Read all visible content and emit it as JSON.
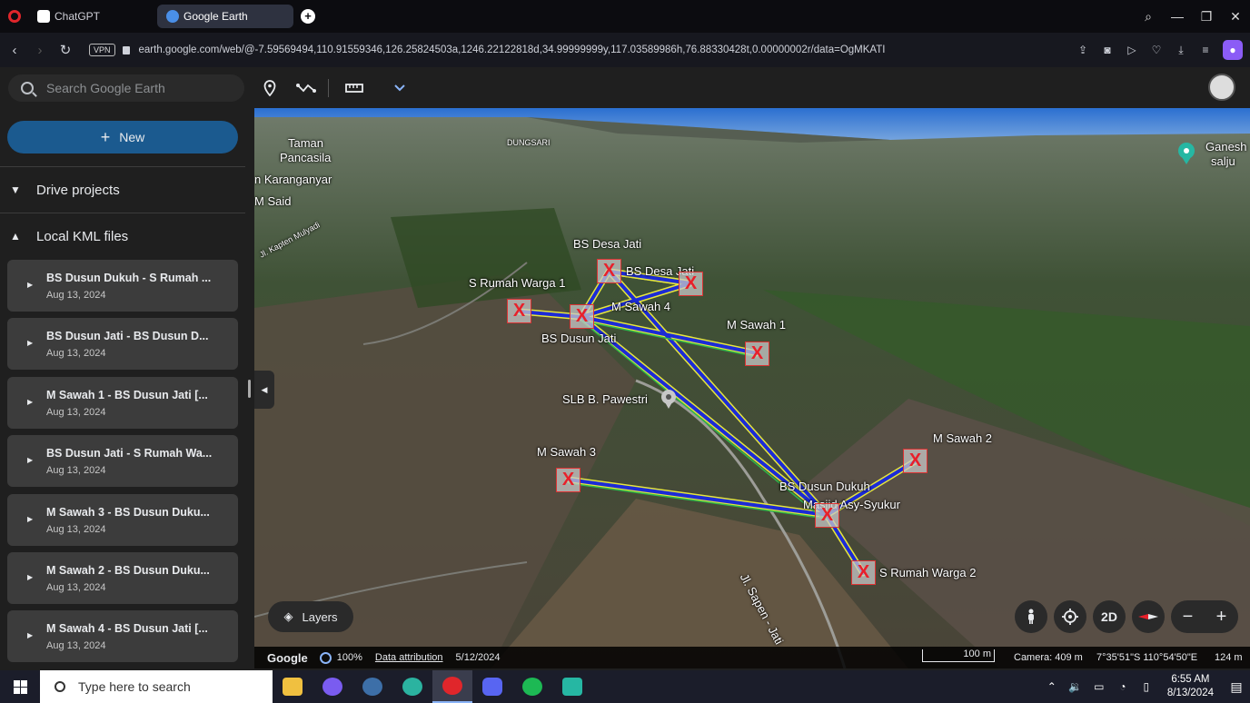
{
  "browser": {
    "tabs": [
      {
        "label": "ChatGPT",
        "active": false
      },
      {
        "label": "Google Earth",
        "active": true
      }
    ],
    "vpn_label": "VPN",
    "url": "earth.google.com/web/@-7.59569494,110.91559346,126.25824503a,1246.22122818d,34.99999999y,117.03589986h,76.88330428t,0.00000002r/data=OgMKATI"
  },
  "toolbar": {
    "search_placeholder": "Search Google Earth",
    "tools": [
      "location-pin-icon",
      "path-icon",
      "ruler-icon",
      "chevron-down-icon"
    ]
  },
  "sidebar": {
    "new_label": "New",
    "sections": [
      "Drive projects",
      "Local KML files"
    ],
    "kml_files": [
      {
        "title": "BS Dusun Dukuh - S Rumah ...",
        "date": "Aug 13, 2024"
      },
      {
        "title": "BS Dusun Jati - BS Dusun D...",
        "date": "Aug 13, 2024"
      },
      {
        "title": "M Sawah 1 - BS Dusun Jati [...",
        "date": "Aug 13, 2024"
      },
      {
        "title": "BS Dusun Jati - S Rumah Wa...",
        "date": "Aug 13, 2024"
      },
      {
        "title": "M Sawah 3 - BS Dusun Duku...",
        "date": "Aug 13, 2024"
      },
      {
        "title": "M Sawah 2 - BS Dusun Duku...",
        "date": "Aug 13, 2024"
      },
      {
        "title": "M Sawah 4 - BS Dusun Jati [...",
        "date": "Aug 13, 2024"
      }
    ]
  },
  "map": {
    "place_labels": {
      "taman1": "Taman",
      "taman2": "Pancasila",
      "dungsari": "DUNGSARI",
      "karanganyar": "n Karanganyar",
      "msaid": "M Said",
      "kapten": "Jl. Kapten Mulyadi",
      "ganesh1": "Ganesh",
      "ganesh2": "salju",
      "slb": "SLB B. Pawestri",
      "masjid": "Masjid Asy-Syukur",
      "jalan": "Jl. Sapen - Jati"
    },
    "marker_glyph": "X",
    "markers": {
      "bs_desa_jati_top": "BS Desa Jati",
      "bs_desa_jati": "BS Desa Jati",
      "s_rumah_warga_1": "S Rumah Warga 1",
      "m_sawah_4": "M Sawah 4",
      "bs_dusun_jati": "BS Dusun Jati",
      "m_sawah_1": "M Sawah 1",
      "m_sawah_3": "M Sawah 3",
      "m_sawah_2": "M Sawah 2",
      "bs_dusun_dukuh": "BS Dusun Dukuh",
      "s_rumah_warga_2": "S Rumah Warga 2"
    },
    "layers_label": "Layers",
    "view_mode": "2D"
  },
  "status": {
    "google": "Google",
    "zoom": "100%",
    "attribution": "Data attribution",
    "date": "5/12/2024",
    "scale": "100 m",
    "camera": "Camera: 409 m",
    "coords": "7°35'51\"S 110°54'50\"E",
    "altitude": "124 m"
  },
  "taskbar": {
    "search_placeholder": "Type here to search",
    "time": "6:55 AM",
    "date": "8/13/2024"
  },
  "colors": {
    "link_yellow": "#e6e63c",
    "link_blue": "#1c2bd6",
    "link_green": "#2fb84a",
    "marker_red": "#e8202a",
    "new_button": "#1b5a8f"
  }
}
